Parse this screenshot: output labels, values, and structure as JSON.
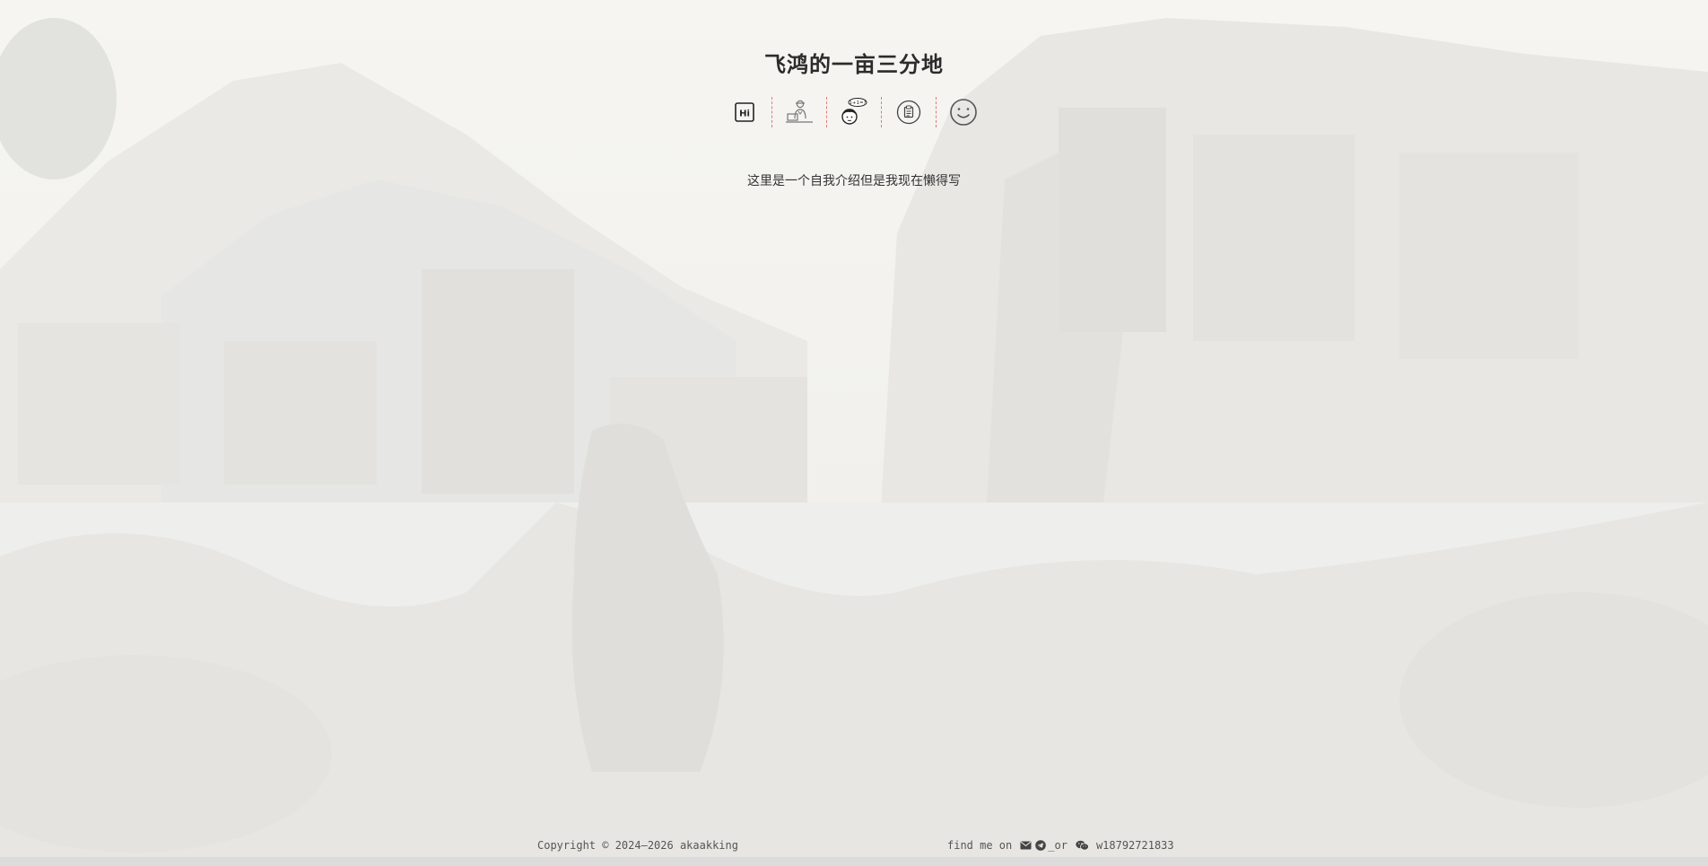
{
  "site": {
    "title": "飞鸿的一亩三分地",
    "intro": "这里是一个自我介绍但是我现在懒得写"
  },
  "nav": {
    "items": [
      {
        "icon": "hi-icon"
      },
      {
        "icon": "coder-icon"
      },
      {
        "icon": "thinking-kid-icon",
        "badge": "1+1=?"
      },
      {
        "icon": "clipboard-icon"
      },
      {
        "icon": "smile-icon"
      }
    ]
  },
  "footer": {
    "copyright": "Copyright © 2024–2026 akaakking",
    "contact_prefix": "find me on",
    "contact_separator": "_or",
    "wechat_id": "w18792721833"
  },
  "colors": {
    "separator": "#d9534f",
    "text": "#333333"
  }
}
